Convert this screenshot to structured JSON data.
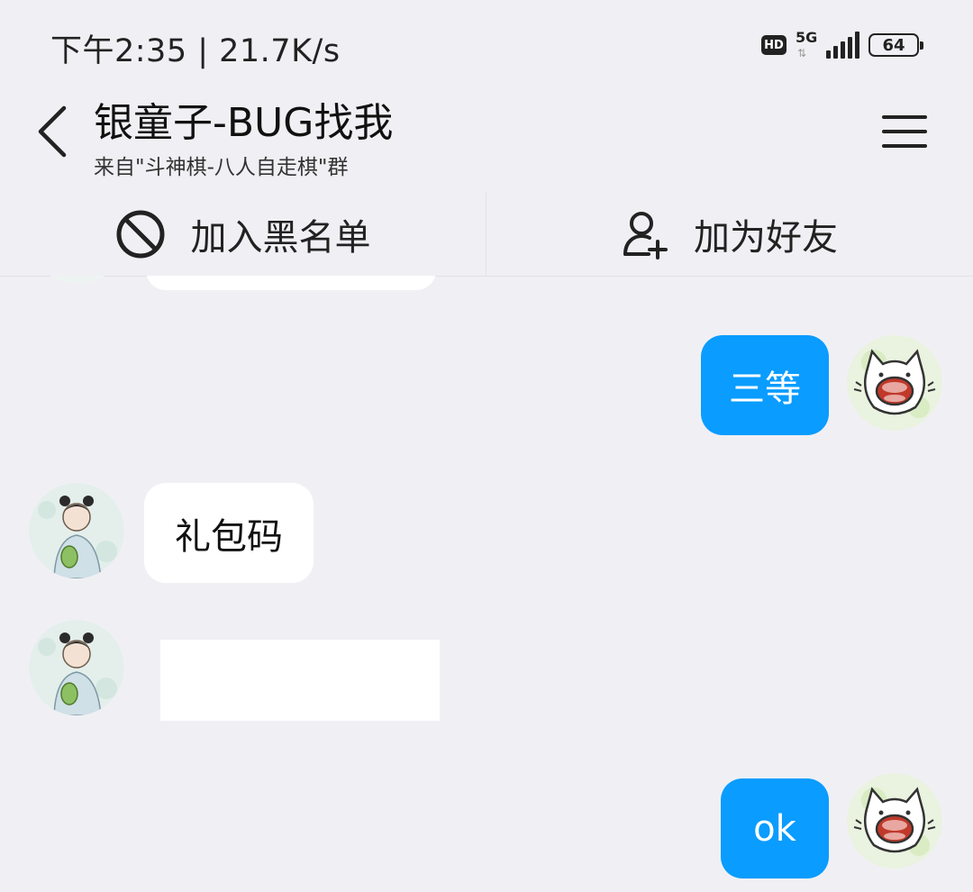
{
  "status_bar": {
    "time_speed": "下午2:35 | 21.7K/s",
    "hd": "HD",
    "network": "5G",
    "network_arrows": "⇅",
    "battery": "64"
  },
  "header": {
    "title": "银童子-BUG找我",
    "subtitle": "来自\"斗神棋-八人自走棋\"群"
  },
  "actions": {
    "block_label": "加入黑名单",
    "add_friend_label": "加为好友"
  },
  "messages": [
    {
      "sender": "me",
      "text": "三等"
    },
    {
      "sender": "them",
      "text": "礼包码"
    },
    {
      "sender": "them",
      "type": "blank-media",
      "text": ""
    },
    {
      "sender": "me",
      "text": "ok"
    }
  ],
  "colors": {
    "my_bubble": "#0a9cff",
    "their_bubble": "#ffffff",
    "background": "#f0f0f4"
  },
  "icons": {
    "back": "chevron-left-icon",
    "menu": "hamburger-menu-icon",
    "block": "no-entry-icon",
    "add_friend": "person-add-icon"
  }
}
